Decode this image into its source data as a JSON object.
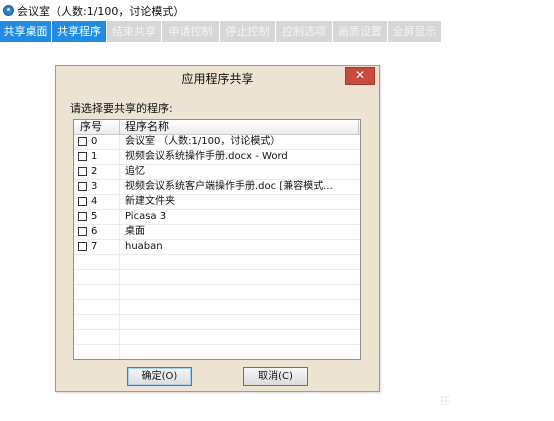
{
  "window": {
    "title": "会议室（人数:1/100，讨论模式）",
    "icon": "meeting-app-icon"
  },
  "toolbar": {
    "buttons": [
      {
        "label": "共享桌面",
        "state": "active"
      },
      {
        "label": "共享程序",
        "state": "active"
      },
      {
        "label": "结束共享",
        "state": "disabled"
      },
      {
        "label": "申请控制",
        "state": "disabled"
      },
      {
        "label": "停止控制",
        "state": "disabled"
      },
      {
        "label": "控制选项",
        "state": "disabled"
      },
      {
        "label": "画质设置",
        "state": "disabled"
      },
      {
        "label": "全屏显示",
        "state": "disabled"
      }
    ],
    "colors": {
      "active": "#1f8de6",
      "disabled": "#d6d6d6"
    }
  },
  "dialog": {
    "title": "应用程序共享",
    "close_label": "✕",
    "prompt": "请选择要共享的程序:",
    "columns": {
      "index": "序号",
      "name": "程序名称"
    },
    "rows": [
      {
        "index": "0",
        "name": "会议室 （人数:1/100，讨论模式）",
        "checked": false
      },
      {
        "index": "1",
        "name": "视频会议系统操作手册.docx - Word",
        "checked": false
      },
      {
        "index": "2",
        "name": "追忆",
        "checked": false
      },
      {
        "index": "3",
        "name": "视频会议系统客户端操作手册.doc [兼容模式...",
        "checked": false
      },
      {
        "index": "4",
        "name": "新建文件夹",
        "checked": false
      },
      {
        "index": "5",
        "name": "Picasa 3",
        "checked": false
      },
      {
        "index": "6",
        "name": "桌面",
        "checked": false
      },
      {
        "index": "7",
        "name": "huaban",
        "checked": false
      }
    ],
    "ok_label": "确定(O)",
    "cancel_label": "取消(C)"
  }
}
